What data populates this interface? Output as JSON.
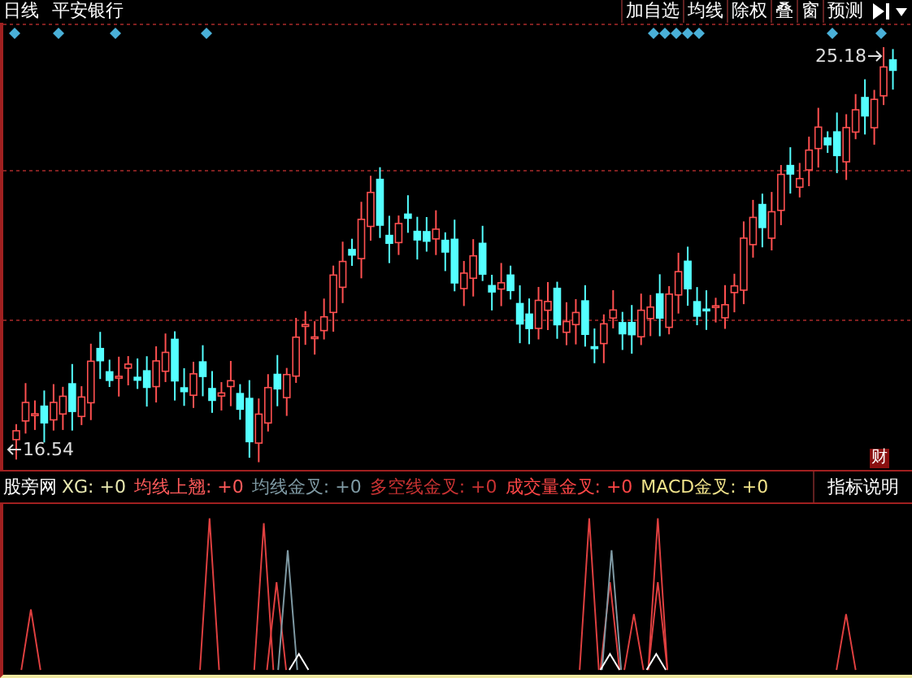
{
  "header": {
    "period": "日线",
    "stock_name": "平安银行"
  },
  "toolbar": [
    {
      "label": "加自选"
    },
    {
      "label": "均线"
    },
    {
      "label": "除权"
    },
    {
      "label": "叠"
    },
    {
      "label": "窗"
    },
    {
      "label": "预测"
    }
  ],
  "price_labels": {
    "high": "25.18",
    "low": "16.54"
  },
  "badge": "财",
  "indicator": {
    "name": "股旁网",
    "button": "指标说明",
    "items": [
      {
        "label": "XG: +0",
        "color": "#e8e8b0"
      },
      {
        "label": "均线上翘: +0",
        "color": "#ff5a5a"
      },
      {
        "label": "均线金叉: +0",
        "color": "#7f9aa4"
      },
      {
        "label": "多空线金叉: +0",
        "color": "#c83232"
      },
      {
        "label": "成交量金叉: +0",
        "color": "#ff4646"
      },
      {
        "label": "MACD金叉: +0",
        "color": "#f0e28a"
      }
    ]
  }
}
